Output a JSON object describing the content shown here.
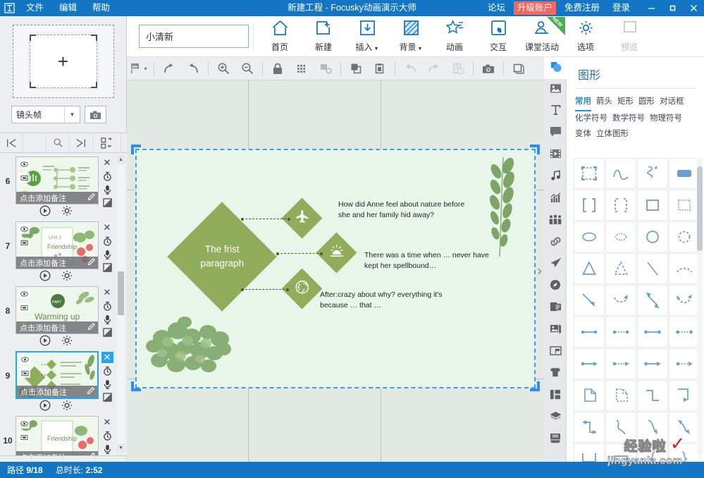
{
  "titlebar": {
    "logo_icon": "focusky-logo-icon",
    "menus": [
      "文件",
      "编辑",
      "帮助"
    ],
    "title": "新建工程 - Focusky动画演示大师",
    "right_links": [
      "论坛",
      "免费注册",
      "登录"
    ],
    "upgrade_label": "升级账户",
    "upgrade_color": "#f4665f",
    "window_controls": {
      "minimize": "—",
      "maximize": "▢",
      "close": "✕"
    },
    "bg_color": "#1276c4"
  },
  "left_panel": {
    "camera_frame": {
      "plus": "+",
      "icon": "camera-frame-icon"
    },
    "camera_select_value": "镜头帧",
    "camera_button_icon": "camera-icon",
    "nav_buttons": [
      {
        "name": "go-first",
        "icon": "first-frame-icon"
      },
      {
        "name": "spacer",
        "icon": ""
      },
      {
        "name": "zoom-search",
        "icon": "search-icon"
      },
      {
        "name": "go-last",
        "icon": "last-frame-icon"
      },
      {
        "name": "reorder",
        "icon": "reorder-icon"
      }
    ],
    "slides": [
      {
        "number": "6",
        "notes": "点击添加备注",
        "selected": false,
        "title": ""
      },
      {
        "number": "7",
        "notes": "点击添加备注",
        "selected": false,
        "title": "Friendship"
      },
      {
        "number": "8",
        "notes": "点击添加备注",
        "selected": false,
        "title": "Warming up"
      },
      {
        "number": "9",
        "notes": "点击添加备注",
        "selected": true,
        "title": ""
      },
      {
        "number": "10",
        "notes": "点击添加备注",
        "selected": false,
        "title": "Friendship"
      }
    ],
    "slide_icons": [
      "close-icon",
      "timer-icon",
      "microphone-icon",
      "transition-icon"
    ],
    "slide_under_icons": [
      "play-icon",
      "settings-gear-icon"
    ],
    "bottom_buttons": [
      "edit-note-icon",
      "bookmark-list-icon",
      "duplicate-slide-icon",
      "no-transition-icon"
    ]
  },
  "toolbar": {
    "theme_input_value": "小清新",
    "buttons": [
      {
        "label": "首页",
        "icon": "home-icon",
        "caret": false,
        "dim": false,
        "badge": ""
      },
      {
        "label": "新建",
        "icon": "new-slide-icon",
        "caret": false,
        "dim": false,
        "badge": ""
      },
      {
        "label": "插入",
        "icon": "insert-icon",
        "caret": true,
        "dim": false,
        "badge": ""
      },
      {
        "label": "背景",
        "icon": "background-icon",
        "caret": true,
        "dim": false,
        "badge": ""
      },
      {
        "label": "动画",
        "icon": "animation-star-icon",
        "caret": false,
        "dim": false,
        "badge": ""
      },
      {
        "label": "交互",
        "icon": "interaction-icon",
        "caret": false,
        "dim": false,
        "badge": ""
      },
      {
        "label": "课堂活动",
        "icon": "classroom-activity-icon",
        "caret": false,
        "dim": false,
        "badge": "NEW"
      },
      {
        "label": "选项",
        "icon": "settings-gear-icon",
        "caret": false,
        "dim": false,
        "badge": ""
      },
      {
        "label": "预览",
        "icon": "preview-icon",
        "caret": false,
        "dim": true,
        "badge": ""
      }
    ]
  },
  "toolbar2": {
    "items": [
      {
        "name": "ruler-guides-button",
        "icon": "ruler-icon",
        "dim": false,
        "caret": true
      },
      {
        "name": "redo-arrow-button",
        "icon": "redo-curve-icon",
        "dim": false,
        "caret": false
      },
      {
        "name": "undo-arrow-button",
        "icon": "undo-curve-icon",
        "dim": false,
        "caret": false
      },
      {
        "name": "zoom-in-button",
        "icon": "zoom-in-icon",
        "dim": false,
        "caret": false
      },
      {
        "name": "zoom-out-button",
        "icon": "zoom-out-icon",
        "dim": false,
        "caret": false
      },
      {
        "name": "lock-button",
        "icon": "lock-icon",
        "dim": false,
        "caret": false
      },
      {
        "name": "grid-button",
        "icon": "grid-icon",
        "dim": false,
        "caret": false
      },
      {
        "name": "align-settings-button",
        "icon": "align-settings-icon",
        "dim": true,
        "caret": false
      },
      {
        "name": "copy-button",
        "icon": "copy-icon",
        "dim": false,
        "caret": false
      },
      {
        "name": "paste-button",
        "icon": "paste-icon",
        "dim": false,
        "caret": false
      },
      {
        "name": "undo-button",
        "icon": "undo-icon",
        "dim": true,
        "caret": false
      },
      {
        "name": "redo-button",
        "icon": "redo-icon",
        "dim": true,
        "caret": false
      },
      {
        "name": "history-button",
        "icon": "history-icon",
        "dim": true,
        "caret": false
      },
      {
        "name": "screenshot-button",
        "icon": "camera-icon",
        "dim": false,
        "caret": false
      },
      {
        "name": "window-button",
        "icon": "window-icon",
        "dim": false,
        "caret": false
      }
    ]
  },
  "canvas": {
    "main_shape_text": "The frist\nparagraph",
    "main_shape_line1": "The frist",
    "main_shape_line2": "paragraph",
    "shape_color": "#8fad5a",
    "nodes": [
      {
        "icon": "airplane-icon",
        "text_line1": "How did Anne feel about nature before",
        "text_line2": "she and her family hid away?"
      },
      {
        "icon": "sunrise-icon",
        "text_line1": "There was a time when … never have",
        "text_line2": "kept her spellbound…"
      },
      {
        "icon": "globe-icon",
        "text_line1": "After:crazy about why? everything it's",
        "text_line2": "because … that …"
      }
    ],
    "next_arrow": "›"
  },
  "vstrip": {
    "items": [
      {
        "name": "shapes-tool",
        "icon": "shapes-icon",
        "active": true
      },
      {
        "name": "image-tool",
        "icon": "image-icon",
        "active": false
      },
      {
        "name": "text-tool",
        "icon": "text-T-icon",
        "active": false
      },
      {
        "name": "bubble-tool",
        "icon": "speech-bubble-icon",
        "active": false
      },
      {
        "name": "video-tool",
        "icon": "video-film-icon",
        "active": false
      },
      {
        "name": "music-tool",
        "icon": "music-note-icon",
        "active": false
      },
      {
        "name": "chart-tool",
        "icon": "chart-icon",
        "active": false
      },
      {
        "name": "characters-tool",
        "icon": "people-icon",
        "active": false
      },
      {
        "name": "link-tool",
        "icon": "link-chain-icon",
        "active": false
      },
      {
        "name": "animation-path-tool",
        "icon": "airplane-icon",
        "active": false
      },
      {
        "name": "compass-tool",
        "icon": "compass-icon",
        "active": false
      },
      {
        "name": "list-tool",
        "icon": "list-page-icon",
        "active": false
      },
      {
        "name": "gallery-tool",
        "icon": "gallery-icon",
        "active": false
      },
      {
        "name": "flag-tool",
        "icon": "flag-window-icon",
        "active": false
      },
      {
        "name": "tshirt-tool",
        "icon": "tshirt-icon",
        "active": false
      },
      {
        "name": "layout-tool",
        "icon": "layout-columns-icon",
        "active": false
      },
      {
        "name": "layers-tool",
        "icon": "layers-stack-icon",
        "active": false
      },
      {
        "name": "archive-tool",
        "icon": "archive-box-icon",
        "active": false
      }
    ]
  },
  "right_panel": {
    "title": "图形",
    "tabs": [
      {
        "label": "常用",
        "active": true
      },
      {
        "label": "箭头",
        "active": false
      },
      {
        "label": "矩形",
        "active": false
      },
      {
        "label": "圆形",
        "active": false
      },
      {
        "label": "对话框",
        "active": false
      },
      {
        "label": "化学符号",
        "active": false
      },
      {
        "label": "数学符号",
        "active": false
      },
      {
        "label": "物理符号",
        "active": false
      },
      {
        "label": "变体",
        "active": false
      },
      {
        "label": "立体图形",
        "active": false
      }
    ],
    "shape_color": "#6b9fd4",
    "shapes": [
      "selection-frame",
      "curve-wave",
      "squiggle-line",
      "filled-rounded-rect",
      "bracket-pair",
      "dashed-bracket-pair",
      "square-outline",
      "dotted-square",
      "ellipse",
      "dotted-ellipse",
      "circle",
      "dashed-circle",
      "triangle",
      "dashed-triangle",
      "diagonal-line",
      "dashed-arc",
      "diagonal-arrow",
      "dashed-curved-arrow",
      "double-diagonal-arrow",
      "dashed-double-curved-arrow",
      "line-dot-dot",
      "dotted-line-dot-dot",
      "line-diamond-diamond",
      "dotted-diamond-line",
      "line-dot-arrow",
      "dotted-line-arrow",
      "line-diamond-arrow",
      "dotted-diamond-arrow",
      "folded-corner-shape",
      "dashed-folded-shape",
      "elbow-connector-z",
      "elbow-connector-arrow",
      "elbow-double-arrow",
      "s-curve",
      "curve-arrow-down",
      "curve-double-arrow",
      "bracket-bottom",
      "bracket-top",
      "brace-left",
      "brace-right"
    ]
  },
  "statusbar": {
    "path_label": "路径",
    "path_value": "9/18",
    "duration_label": "总时长:",
    "duration_value": "2:52",
    "bg_color": "#1276c4"
  },
  "watermark": {
    "cn": "经验啦",
    "en": "jingyanla.com",
    "check": "✓"
  }
}
